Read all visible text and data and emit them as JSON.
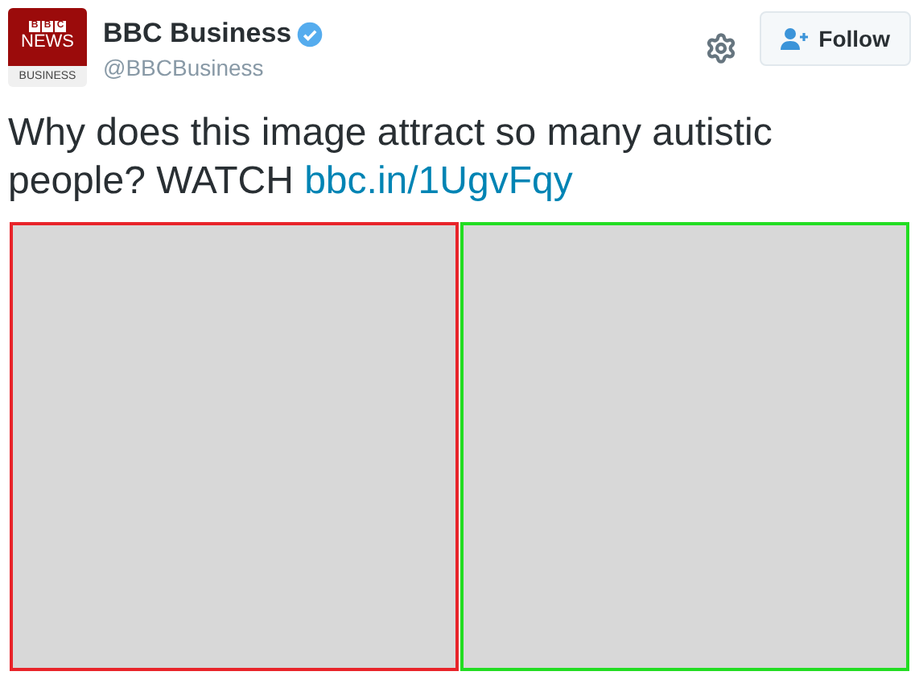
{
  "account": {
    "logo": {
      "blocks": [
        "B",
        "B",
        "C"
      ],
      "middle": "NEWS",
      "bottom": "BUSINESS"
    },
    "name": "BBC Business",
    "verified": true,
    "handle": "@BBCBusiness"
  },
  "follow_button": {
    "label": "Follow"
  },
  "tweet": {
    "text": "Why does this image attract so many autistic people? WATCH",
    "link": "bbc.in/1UgvFqy"
  },
  "image_panels": [
    {
      "color": "#e8242a"
    },
    {
      "color": "#22dd22"
    }
  ]
}
